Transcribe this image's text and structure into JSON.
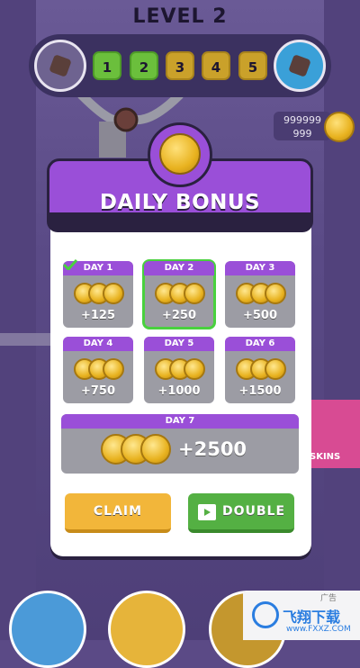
{
  "game": {
    "level_title": "LEVEL 2"
  },
  "progress": {
    "levels": [
      "1",
      "2",
      "3",
      "4",
      "5"
    ],
    "completed_count": 2
  },
  "wallet": {
    "coins_line1": "999999",
    "coins_line2": "999"
  },
  "side_button": {
    "label": "SKINS"
  },
  "modal": {
    "title": "DAILY BONUS",
    "days": [
      {
        "label": "DAY 1",
        "amount": "+125",
        "claimed": true
      },
      {
        "label": "DAY 2",
        "amount": "+250",
        "selected": true
      },
      {
        "label": "DAY 3",
        "amount": "+500"
      },
      {
        "label": "DAY 4",
        "amount": "+750"
      },
      {
        "label": "DAY 5",
        "amount": "+1000"
      },
      {
        "label": "DAY 6",
        "amount": "+1500"
      }
    ],
    "day7": {
      "label": "DAY 7",
      "amount": "+2500"
    },
    "claim_label": "CLAIM",
    "double_label": "DOUBLE"
  },
  "ad": {
    "title": "飞翔下载",
    "subtitle": "www.FXXZ.COM",
    "badge": "广告"
  },
  "colors": {
    "accent": "#9a4fd8",
    "green": "#54b043",
    "gold": "#f2b63a"
  }
}
